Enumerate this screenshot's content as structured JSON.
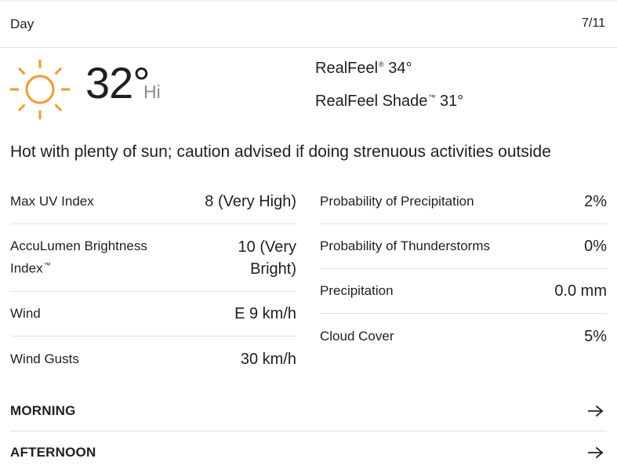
{
  "header": {
    "title": "Day",
    "date": "7/11"
  },
  "current": {
    "icon": "sun-icon",
    "icon_color": "#f29a2e",
    "temperature": "32°",
    "hi_label": "Hi",
    "realfeel_label": "RealFeel",
    "realfeel_value": "34°",
    "realfeel_shade_label": "RealFeel Shade",
    "realfeel_shade_value": "31°",
    "phrase": "Hot with plenty of sun; caution advised if doing strenuous activities outside"
  },
  "details_left": [
    {
      "label": "Max UV Index",
      "value": "8 (Very High)"
    },
    {
      "label": "AccuLumen Brightness Index",
      "value": "10 (Very Bright)"
    },
    {
      "label": "Wind",
      "value": "E 9 km/h"
    },
    {
      "label": "Wind Gusts",
      "value": "30 km/h"
    }
  ],
  "details_right": [
    {
      "label": "Probability of Precipitation",
      "value": "2%"
    },
    {
      "label": "Probability of Thunderstorms",
      "value": "0%"
    },
    {
      "label": "Precipitation",
      "value": "0.0 mm"
    },
    {
      "label": "Cloud Cover",
      "value": "5%"
    }
  ],
  "sections": [
    {
      "title": "MORNING",
      "icon": "arrow-right-icon"
    },
    {
      "title": "AFTERNOON",
      "icon": "arrow-right-icon"
    }
  ]
}
